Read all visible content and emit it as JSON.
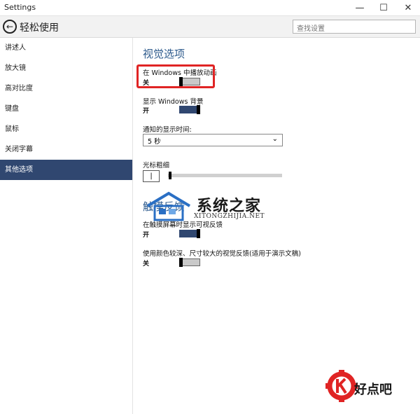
{
  "window": {
    "title": "Settings",
    "minimize": "—",
    "maximize": "☐",
    "close": "✕"
  },
  "header": {
    "back_glyph": "←",
    "title": "轻松使用",
    "search_placeholder": "查找设置"
  },
  "sidebar": {
    "items": [
      {
        "label": "讲述人"
      },
      {
        "label": "放大镜"
      },
      {
        "label": "高对比度"
      },
      {
        "label": "键盘"
      },
      {
        "label": "鼠标"
      },
      {
        "label": "关闭字幕"
      },
      {
        "label": "其他选项",
        "active": true
      }
    ]
  },
  "main": {
    "section_title": "视觉选项",
    "animations": {
      "label": "在 Windows 中播放动画",
      "state": "关",
      "on": false
    },
    "background": {
      "label": "显示 Windows 背景",
      "state": "开",
      "on": true
    },
    "notification": {
      "label": "通知的显示时间:",
      "value": "5 秒"
    },
    "cursor": {
      "label": "光标粗细",
      "value": "|",
      "level": 0.0
    },
    "touch_section_title": "触摸反馈",
    "touch_feedback": {
      "label": "在触摸屏幕时显示可视反馈",
      "state": "开",
      "on": true
    },
    "darker_feedback": {
      "label": "使用颜色较深、尺寸较大的视觉反馈(适用于演示文稿)",
      "state": "关",
      "on": false
    }
  },
  "watermark": {
    "text": "系统之家",
    "sub": "XITONGZHIJIA.NET",
    "logo2": "好点吧"
  },
  "colors": {
    "accent": "#304770",
    "section_title": "#2d5a8c",
    "highlight": "#e02424"
  }
}
